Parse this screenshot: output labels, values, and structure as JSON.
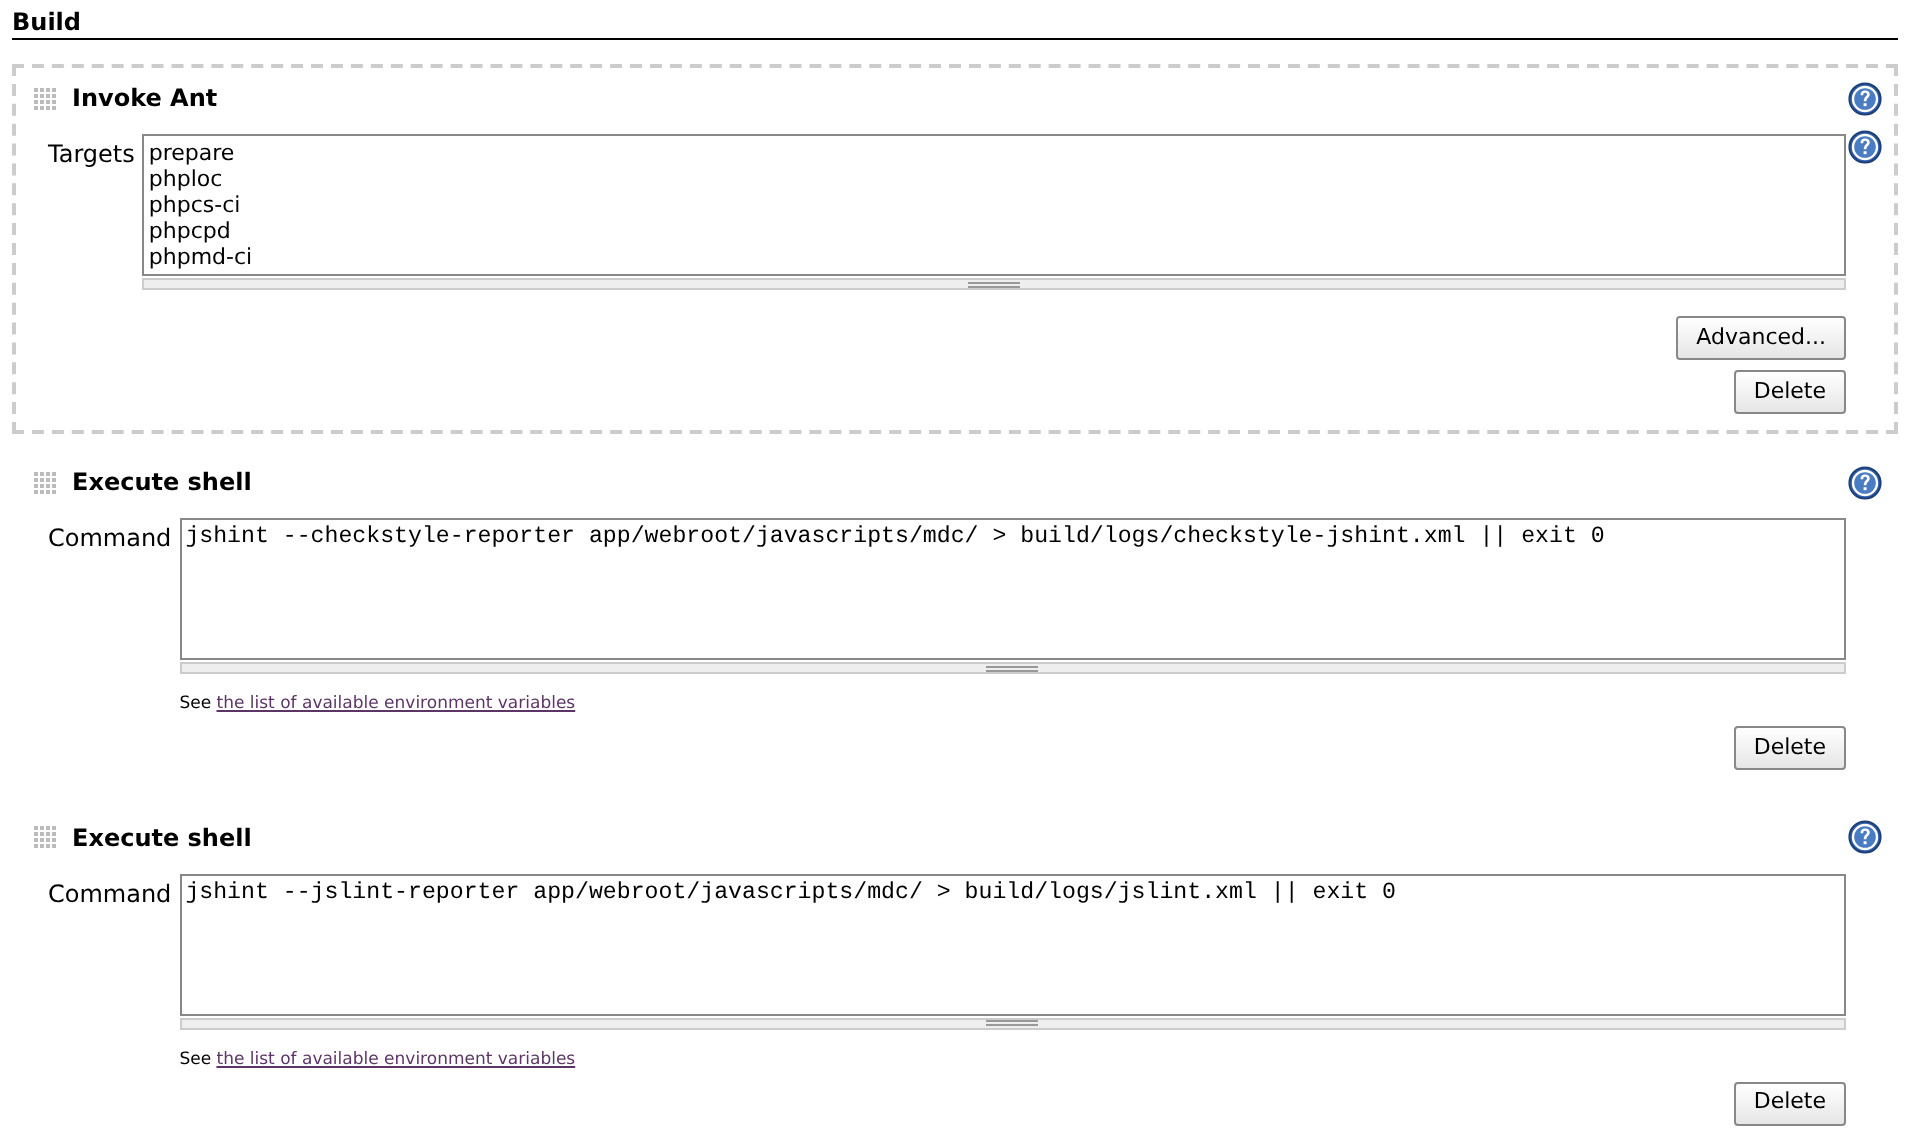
{
  "section": {
    "title": "Build"
  },
  "steps": [
    {
      "kind": "ant",
      "highlighted": true,
      "title": "Invoke Ant",
      "field_label": "Targets",
      "value": "prepare\nphploc\nphpcs-ci\nphpcpd\nphpmd-ci",
      "buttons": [
        "Advanced...",
        "Delete"
      ]
    },
    {
      "kind": "shell",
      "highlighted": false,
      "title": "Execute shell",
      "field_label": "Command",
      "value": "jshint --checkstyle-reporter app/webroot/javascripts/mdc/ > build/logs/checkstyle-jshint.xml || exit 0",
      "hint": "See",
      "hint_link": "the list of available environment variables",
      "buttons": [
        "Delete"
      ]
    },
    {
      "kind": "shell",
      "highlighted": false,
      "title": "Execute shell",
      "field_label": "Command",
      "value": "jshint --jslint-reporter app/webroot/javascripts/mdc/ > build/logs/jslint.xml || exit 0",
      "hint": "See",
      "hint_link": "the list of available environment variables",
      "buttons": [
        "Delete"
      ]
    }
  ]
}
